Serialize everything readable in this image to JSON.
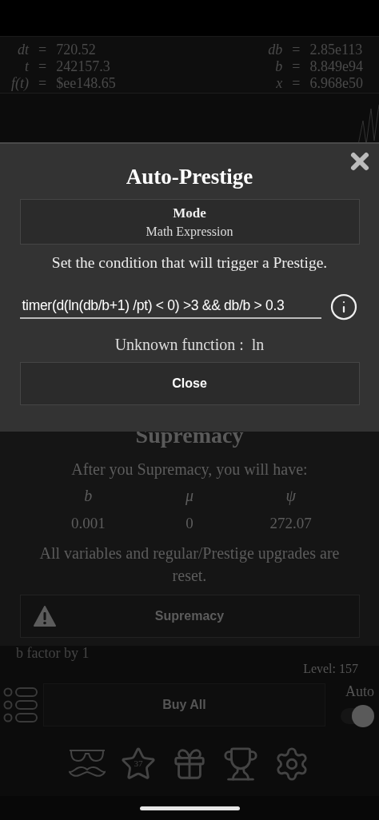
{
  "stats": {
    "left": [
      {
        "symbol": "dt",
        "relation": "=",
        "value": "720.52"
      },
      {
        "symbol": "t",
        "relation": "=",
        "value": "242157.3"
      },
      {
        "symbol": "f(t)",
        "relation": "=",
        "value": "$ee148.65"
      }
    ],
    "right": [
      {
        "symbol": "db",
        "relation": "=",
        "value": "2.85e113"
      },
      {
        "symbol": "b",
        "relation": "=",
        "value": "8.849e94"
      },
      {
        "symbol": "x",
        "relation": "=",
        "value": "6.968e50"
      }
    ]
  },
  "modal": {
    "title": "Auto-Prestige",
    "mode_label": "Mode",
    "mode_value": "Math Expression",
    "description": "Set the condition that will trigger a Prestige.",
    "expression": "timer(d(ln(db/b+1) /pt) < 0) >3 && db/b > 0.3",
    "error": "Unknown function :  ln",
    "close_label": "Close"
  },
  "supremacy": {
    "title": "Supremacy",
    "intro": "After you Supremacy, you will have:",
    "columns": [
      {
        "symbol": "b",
        "value": "0.001"
      },
      {
        "symbol": "μ",
        "value": "0"
      },
      {
        "symbol": "ψ",
        "value": "272.07"
      }
    ],
    "note": "All variables and regular/Prestige upgrades are reset.",
    "button": "Supremacy"
  },
  "upgrade": {
    "description": "b factor by 1",
    "level": "Level: 157"
  },
  "buy_all": {
    "label": "Buy All",
    "auto_label": "Auto",
    "auto_on": true
  },
  "nav": [
    {
      "kind": "students"
    },
    {
      "kind": "stars",
      "badge": "37"
    },
    {
      "kind": "gift"
    },
    {
      "kind": "trophy"
    },
    {
      "kind": "settings"
    }
  ]
}
